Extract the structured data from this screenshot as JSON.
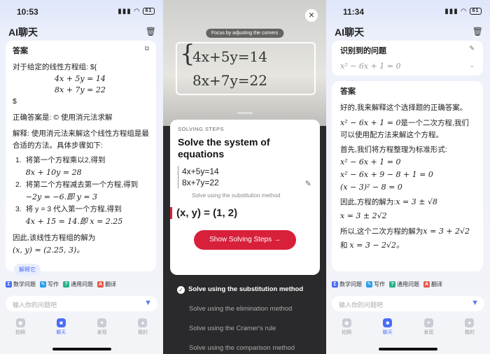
{
  "left": {
    "time": "10:53",
    "battery": "61",
    "title": "AI聊天",
    "answer_header": "答案",
    "line1": "对于给定的线性方程组: ${",
    "eq1": "4x + 5y = 14",
    "eq2": "8x + 7y = 22",
    "dollar": "$",
    "correct": "正确答案是: © 使用消元法求解",
    "explain": "解释: 使用消元法来解这个线性方程组是最合适的方法。具体步骤如下:",
    "steps": [
      {
        "n": "1.",
        "t": "将第一个方程乘以2,得到",
        "m": "8x + 10y = 28"
      },
      {
        "n": "2.",
        "t": "将第二个方程减去第一个方程,得到",
        "m": "−2y = −6.即 y = 3"
      },
      {
        "n": "3.",
        "t": "将 y = 3 代入第一个方程,得到",
        "m": "4x + 15 = 14.即 x = 2.25"
      }
    ],
    "conclusion": "因此,该线性方程组的解为",
    "result": "(x, y) = (2.25, 3)。",
    "solve_btn": "解释它",
    "chips": [
      {
        "label": "数学问题",
        "color": "#4a6cf7",
        "icon": "Σ"
      },
      {
        "label": "写作",
        "color": "#2f9de8",
        "icon": "✎"
      },
      {
        "label": "通用问题",
        "color": "#29b08a",
        "icon": "?"
      },
      {
        "label": "翻译",
        "color": "#e8574a",
        "icon": "A"
      }
    ],
    "input_placeholder": "输入你的问题吧",
    "tabs": [
      {
        "label": "拍照",
        "icon": "◉"
      },
      {
        "label": "聊天",
        "icon": "■"
      },
      {
        "label": "发现",
        "icon": "✦"
      },
      {
        "label": "我的",
        "icon": "●"
      }
    ]
  },
  "middle": {
    "close": "×",
    "hint": "Focus by adjusting the corners",
    "photo_eq1": "4x+5y=14",
    "photo_eq2": "8x+7y=22",
    "solving_label": "SOLVING STEPS",
    "heading": "Solve the system of equations",
    "eq1": "4x+5y=14",
    "eq2": "8x+7y=22",
    "method_note": "Solve using the substitution method",
    "answer": "(x, y) = (1, 2)",
    "button": "Show Solving Steps",
    "methods": [
      {
        "label": "Solve using the substitution method",
        "selected": true
      },
      {
        "label": "Solve using the elimination method",
        "selected": false
      },
      {
        "label": "Solve using the Cramer's rule",
        "selected": false
      },
      {
        "label": "Solve using the comparison method",
        "selected": false
      }
    ]
  },
  "right": {
    "time": "11:34",
    "battery": "61",
    "title": "AI聊天",
    "recognized_header": "识别到的问题",
    "recognized_eq": "x² − 6x + 1 = 0",
    "answer_header": "答案",
    "p1": "好的,我来解释这个选择题的正确答案。",
    "p2a": "x² − 6x + 1 = 0",
    "p2b": "是一个二次方程,我们可以使用配方法来解这个方程。",
    "p3": "首先,我们将方程整理为标准形式:",
    "m1": "x² − 6x + 1 = 0",
    "m2": "x² − 6x + 9 − 8 + 1 = 0",
    "m3": "(x − 3)² − 8 = 0",
    "p4": "因此,方程的解为:",
    "p4m": "x = 3 ± √8",
    "m4": "x = 3 ± 2√2",
    "p5": "所以,这个二次方程的解为",
    "p5m": "x = 3 + 2√2",
    "p6": "和",
    "p6m": "x = 3 − 2√2。",
    "chips": [
      {
        "label": "数学问题",
        "color": "#4a6cf7",
        "icon": "Σ"
      },
      {
        "label": "写作",
        "color": "#2f9de8",
        "icon": "✎"
      },
      {
        "label": "通用问题",
        "color": "#29b08a",
        "icon": "?"
      },
      {
        "label": "翻译",
        "color": "#e8574a",
        "icon": "A"
      }
    ],
    "input_placeholder": "输入你的问题吧",
    "tabs": [
      {
        "label": "拍照",
        "icon": "◉"
      },
      {
        "label": "聊天",
        "icon": "■"
      },
      {
        "label": "发现",
        "icon": "✦"
      },
      {
        "label": "我的",
        "icon": "●"
      }
    ]
  }
}
